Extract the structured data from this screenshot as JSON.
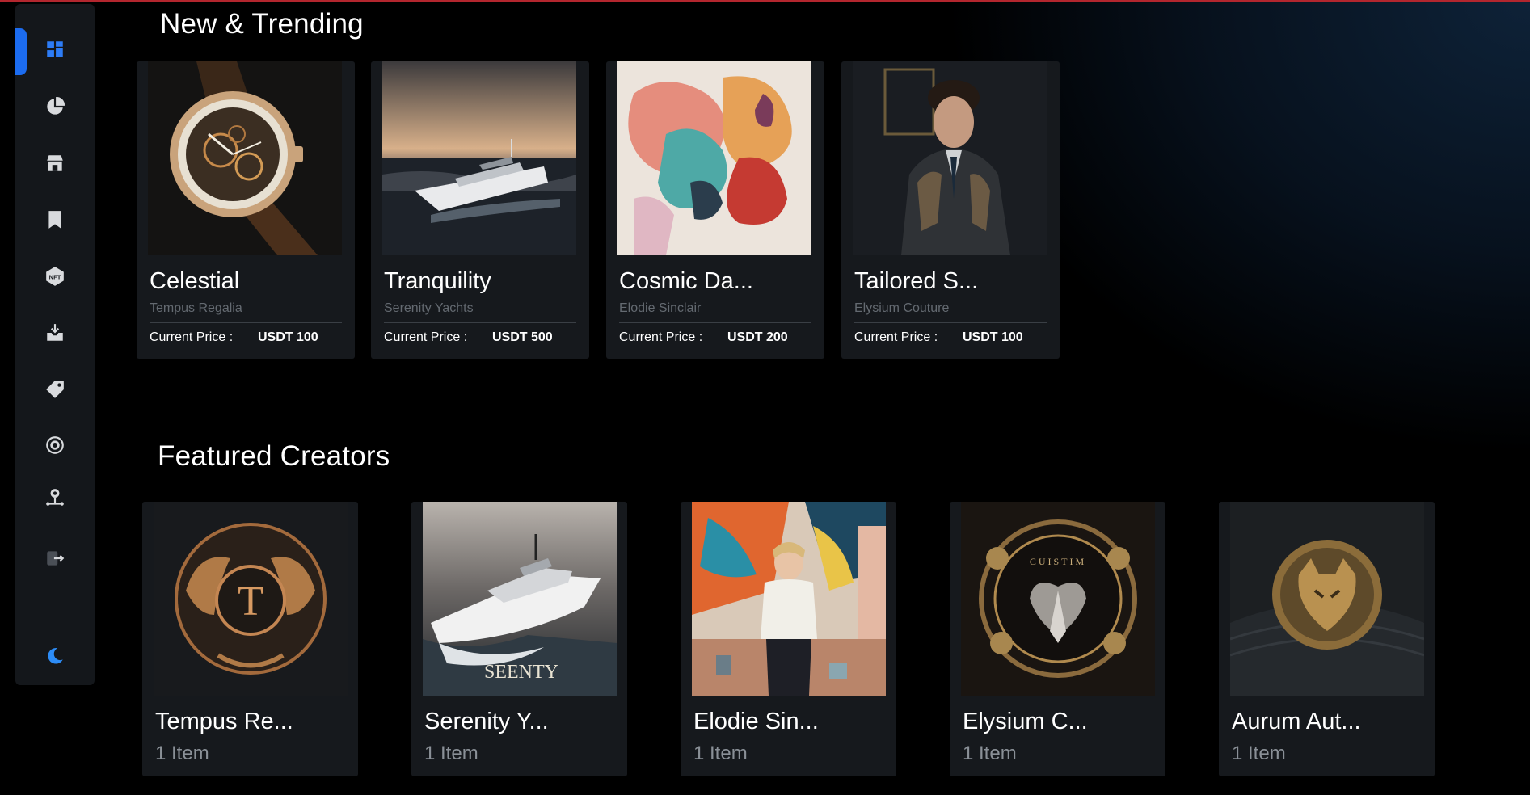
{
  "sidebar": {
    "items": [
      {
        "icon": "dashboard-icon",
        "active": true
      },
      {
        "icon": "pie-chart-icon",
        "active": false
      },
      {
        "icon": "storefront-icon",
        "active": false
      },
      {
        "icon": "bookmark-icon",
        "active": false
      },
      {
        "icon": "nft-icon",
        "active": false
      },
      {
        "icon": "inbox-download-icon",
        "active": false
      },
      {
        "icon": "tag-icon",
        "active": false
      },
      {
        "icon": "settings-cycle-icon",
        "active": false
      },
      {
        "icon": "user-network-icon",
        "active": false
      },
      {
        "icon": "logout-icon",
        "active": false
      }
    ],
    "theme_icon": "moon-icon",
    "accent": "#1c6cf0"
  },
  "trending": {
    "title": "New & Trending",
    "price_label": "Current Price :",
    "cards": [
      {
        "title": "Celestial",
        "creator": "Tempus Regalia",
        "price": "USDT 100"
      },
      {
        "title": "Tranquility",
        "creator": "Serenity Yachts",
        "price": "USDT 500"
      },
      {
        "title": "Cosmic Da...",
        "creator": "Elodie Sinclair",
        "price": "USDT 200"
      },
      {
        "title": "Tailored S...",
        "creator": "Elysium Couture",
        "price": "USDT 100"
      }
    ]
  },
  "creators": {
    "title": "Featured Creators",
    "cards": [
      {
        "name": "Tempus Re...",
        "count": "1 Item",
        "logo_text": "T"
      },
      {
        "name": "Serenity Y...",
        "count": "1 Item",
        "logo_text": "SEENTY"
      },
      {
        "name": "Elodie Sin...",
        "count": "1 Item"
      },
      {
        "name": "Elysium C...",
        "count": "1 Item",
        "logo_text": "CUISTIM"
      },
      {
        "name": "Aurum Aut...",
        "count": "1 Item"
      }
    ]
  },
  "colors": {
    "background": "#000000",
    "card": "#16191d",
    "muted_text": "#646a71",
    "top_line": "#b3262e"
  }
}
